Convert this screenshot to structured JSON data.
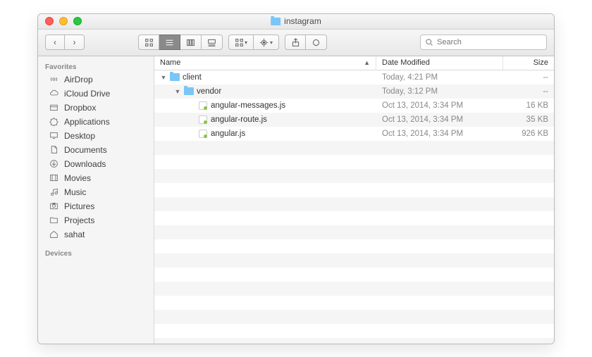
{
  "window": {
    "title": "instagram",
    "search_placeholder": "Search"
  },
  "sidebar": {
    "sections": [
      {
        "header": "Favorites"
      },
      {
        "header": "Devices"
      }
    ],
    "items": [
      {
        "label": "AirDrop",
        "icon": "airdrop"
      },
      {
        "label": "iCloud Drive",
        "icon": "cloud"
      },
      {
        "label": "Dropbox",
        "icon": "box"
      },
      {
        "label": "Applications",
        "icon": "apps"
      },
      {
        "label": "Desktop",
        "icon": "desktop"
      },
      {
        "label": "Documents",
        "icon": "documents"
      },
      {
        "label": "Downloads",
        "icon": "downloads"
      },
      {
        "label": "Movies",
        "icon": "movies"
      },
      {
        "label": "Music",
        "icon": "music"
      },
      {
        "label": "Pictures",
        "icon": "pictures"
      },
      {
        "label": "Projects",
        "icon": "folder"
      },
      {
        "label": "sahat",
        "icon": "home"
      }
    ]
  },
  "columns": {
    "name": "Name",
    "date": "Date Modified",
    "size": "Size"
  },
  "files": [
    {
      "name": "client",
      "type": "folder",
      "indent": 0,
      "expanded": true,
      "date": "Today, 4:21 PM",
      "size": "--"
    },
    {
      "name": "vendor",
      "type": "folder",
      "indent": 1,
      "expanded": true,
      "date": "Today, 3:12 PM",
      "size": "--"
    },
    {
      "name": "angular-messages.js",
      "type": "js",
      "indent": 2,
      "date": "Oct 13, 2014, 3:34 PM",
      "size": "16 KB"
    },
    {
      "name": "angular-route.js",
      "type": "js",
      "indent": 2,
      "date": "Oct 13, 2014, 3:34 PM",
      "size": "35 KB"
    },
    {
      "name": "angular.js",
      "type": "js",
      "indent": 2,
      "date": "Oct 13, 2014, 3:34 PM",
      "size": "926 KB"
    }
  ]
}
